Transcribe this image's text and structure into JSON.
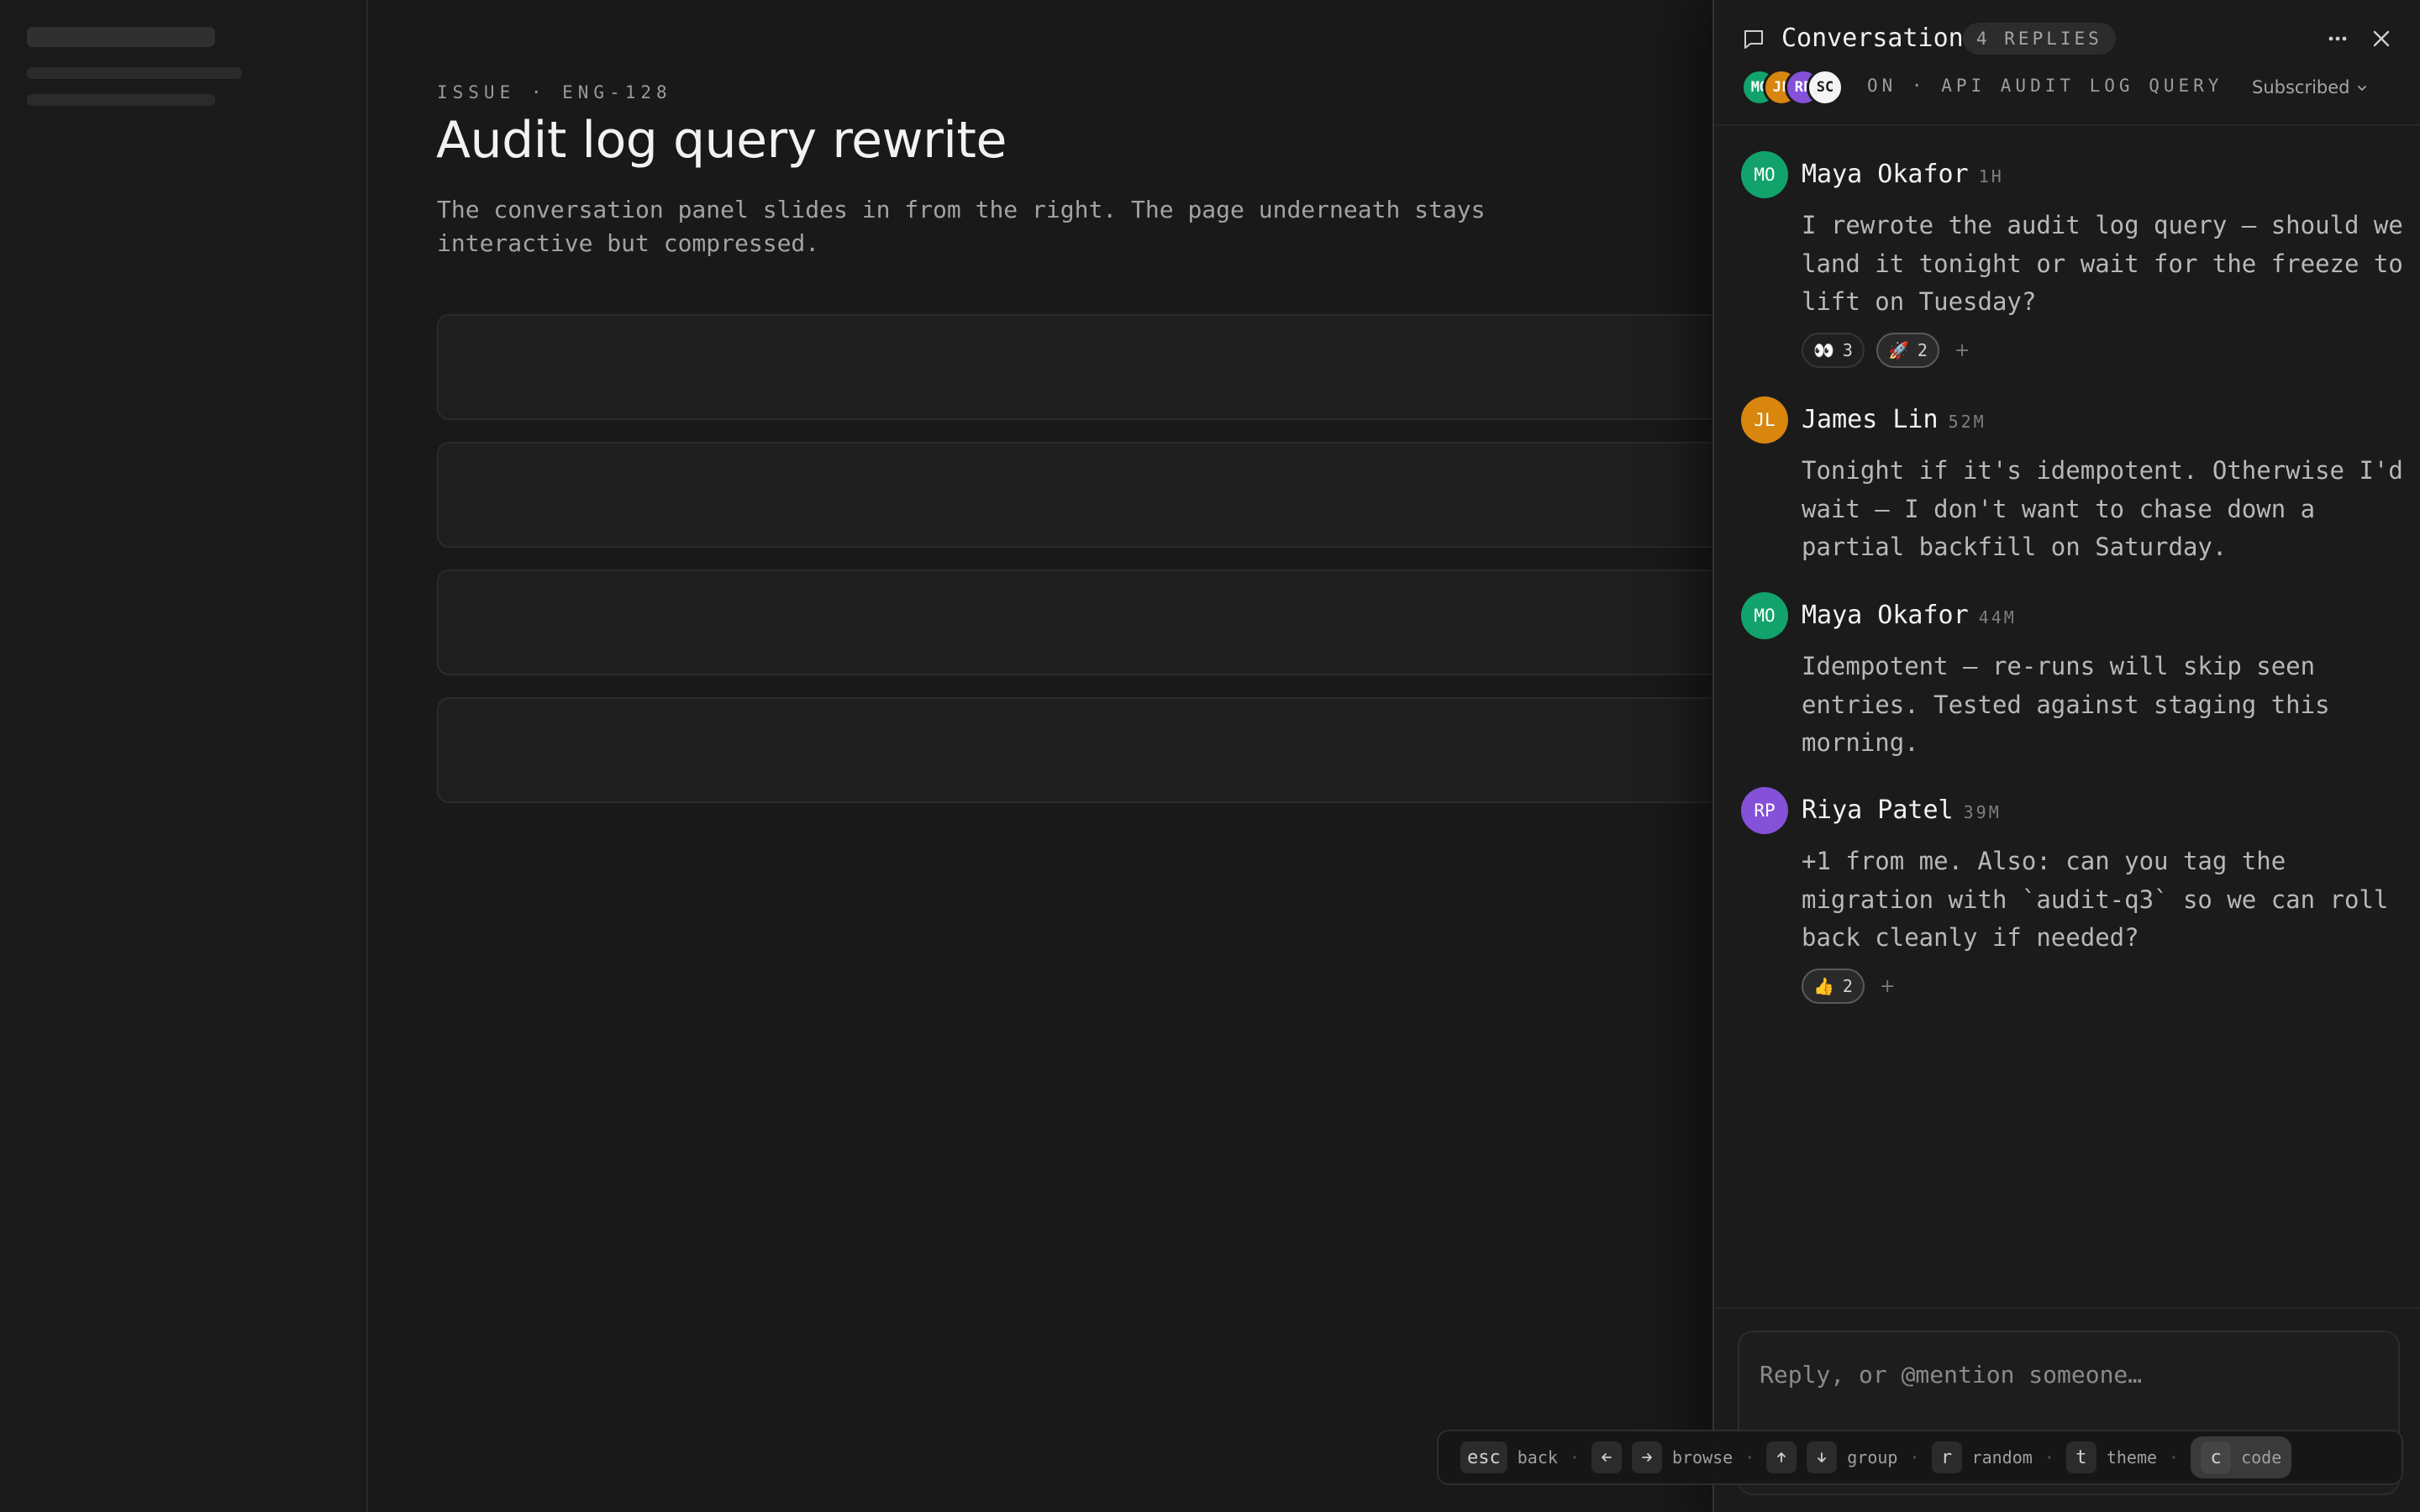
{
  "issue": {
    "kicker": "ISSUE · ENG-128",
    "title": "Audit log query rewrite",
    "description": "The conversation panel slides in from the right. The page underneath stays interactive but compressed."
  },
  "panel": {
    "title": "Conversation",
    "replies_badge": "4 REPLIES",
    "context": "ON · API AUDIT LOG QUERY",
    "subscribed_label": "Subscribed",
    "participants": [
      {
        "initials": "MO",
        "color": "#12a36d"
      },
      {
        "initials": "JL",
        "color": "#d9860f"
      },
      {
        "initials": "RP",
        "color": "#8451d8"
      },
      {
        "initials": "SC",
        "color": "#f4f4f4"
      }
    ]
  },
  "messages": [
    {
      "initials": "MO",
      "color": "#12a36d",
      "author": "Maya Okafor",
      "time": "1H",
      "body": "I rewrote the audit log query — should we land it tonight or wait for the freeze to lift on Tuesday?",
      "reactions": [
        {
          "emoji": "👀",
          "count": "3",
          "active": false
        },
        {
          "emoji": "🚀",
          "count": "2",
          "active": true
        }
      ]
    },
    {
      "initials": "JL",
      "color": "#d9860f",
      "author": "James Lin",
      "time": "52M",
      "body": "Tonight if it's idempotent. Otherwise I'd wait — I don't want to chase down a partial backfill on Saturday.",
      "reactions": []
    },
    {
      "initials": "MO",
      "color": "#12a36d",
      "author": "Maya Okafor",
      "time": "44M",
      "body": "Idempotent — re-runs will skip seen entries. Tested against staging this morning.",
      "reactions": []
    },
    {
      "initials": "RP",
      "color": "#8451d8",
      "author": "Riya Patel",
      "time": "39M",
      "body": "+1 from me. Also: can you tag the migration with `audit-q3` so we can roll back cleanly if needed?",
      "reactions": [
        {
          "emoji": "👍",
          "count": "2",
          "active": true
        }
      ]
    }
  ],
  "add_reaction_label": "+",
  "composer": {
    "placeholder": "Reply, or @mention someone…"
  },
  "shortcuts": {
    "esc_key": "esc",
    "esc_label": "back",
    "browse_label": "browse",
    "group_label": "group",
    "random_key": "r",
    "random_label": "random",
    "theme_key": "t",
    "theme_label": "theme",
    "code_key": "c",
    "code_label": "code",
    "separator": "·"
  },
  "icons": {
    "conversation": "speech-bubble-icon",
    "more": "more-horizontal-icon",
    "close": "close-icon",
    "chevron": "chevron-down-icon",
    "arrow_left": "arrow-left-icon",
    "arrow_right": "arrow-right-icon",
    "arrow_up": "arrow-up-icon",
    "arrow_down": "arrow-down-icon"
  }
}
